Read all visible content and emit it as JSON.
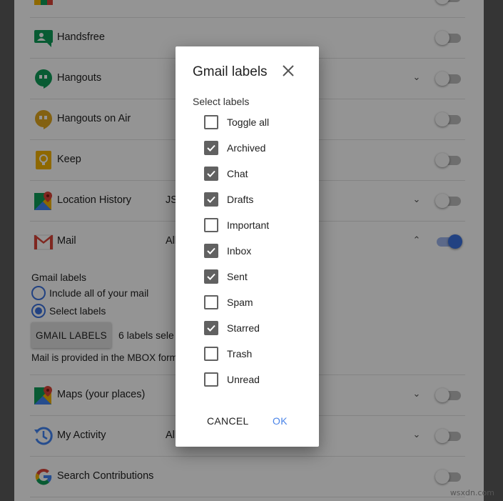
{
  "products": [
    {
      "name": "Handsfree",
      "format": "",
      "icon": "handsfree-icon",
      "chevron": false,
      "toggle_on": false
    },
    {
      "name": "Hangouts",
      "format": "",
      "icon": "hangouts-icon",
      "chevron": true,
      "toggle_on": false
    },
    {
      "name": "Hangouts on Air",
      "format": "",
      "icon": "hangouts-on-air-icon",
      "chevron": false,
      "toggle_on": false
    },
    {
      "name": "Keep",
      "format": "",
      "icon": "keep-icon",
      "chevron": false,
      "toggle_on": false
    },
    {
      "name": "Location History",
      "format": "JS",
      "icon": "location-history-icon",
      "chevron": true,
      "toggle_on": false
    },
    {
      "name": "Mail",
      "format": "All",
      "icon": "gmail-icon",
      "chevron": true,
      "toggle_on": true
    }
  ],
  "products_after": [
    {
      "name": "Maps (your places)",
      "format": "",
      "icon": "maps-icon",
      "chevron": true,
      "toggle_on": false
    },
    {
      "name": "My Activity",
      "format": "All",
      "icon": "my-activity-icon",
      "chevron": true,
      "toggle_on": false
    },
    {
      "name": "Search Contributions",
      "format": "",
      "icon": "google-icon",
      "chevron": false,
      "toggle_on": false
    }
  ],
  "mail": {
    "section_label": "Gmail labels",
    "option_all": "Include all of your mail",
    "option_select": "Select labels",
    "button": "GMAIL LABELS",
    "count": "6 labels sele",
    "note": "Mail is provided in the MBOX form"
  },
  "dialog": {
    "title": "Gmail labels",
    "subtitle": "Select labels",
    "labels": [
      {
        "label": "Toggle all",
        "checked": false
      },
      {
        "label": "Archived",
        "checked": true
      },
      {
        "label": "Chat",
        "checked": true
      },
      {
        "label": "Drafts",
        "checked": true
      },
      {
        "label": "Important",
        "checked": false
      },
      {
        "label": "Inbox",
        "checked": true
      },
      {
        "label": "Sent",
        "checked": true
      },
      {
        "label": "Spam",
        "checked": false
      },
      {
        "label": "Starred",
        "checked": true
      },
      {
        "label": "Trash",
        "checked": false
      },
      {
        "label": "Unread",
        "checked": false
      }
    ],
    "cancel": "CANCEL",
    "ok": "OK"
  },
  "colors": {
    "accent": "#3b73e0",
    "ok_text": "#4a84e8",
    "checkbox": "#616161"
  },
  "watermark": "wsxdn.com"
}
